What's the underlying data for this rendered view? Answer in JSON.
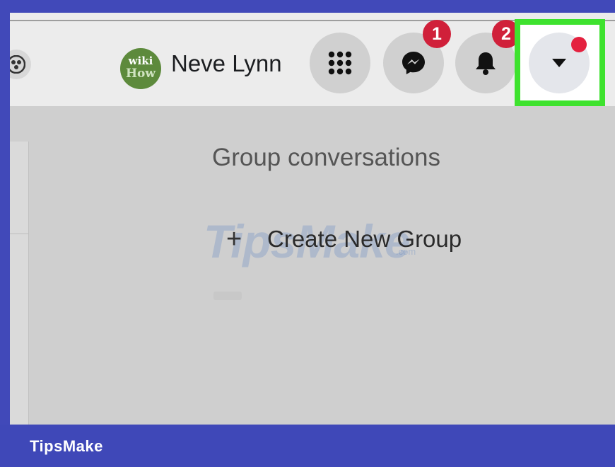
{
  "header": {
    "user": {
      "avatar_line1": "wiki",
      "avatar_line2": "How",
      "name": "Neve Lynn"
    },
    "menu_icon": "grid-menu-icon",
    "messenger": {
      "icon": "messenger-icon",
      "badge": "1"
    },
    "notifications": {
      "icon": "bell-icon",
      "badge": "2"
    },
    "account": {
      "icon": "caret-down-icon",
      "dot_color": "#e4213f"
    },
    "highlight_color": "#3ee22e"
  },
  "main": {
    "heading": "Group conversations",
    "create_icon": "+",
    "create_label": "Create New Group"
  },
  "watermark": {
    "text": "TipsMake",
    "suffix": ".com"
  },
  "footer": {
    "brand": "TipsMake",
    "color": "#3f48b8"
  }
}
